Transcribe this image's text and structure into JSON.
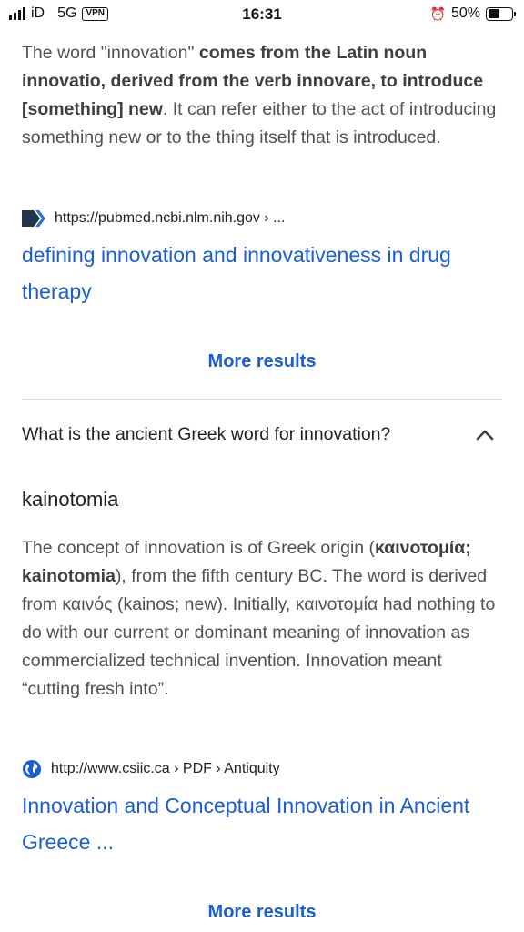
{
  "status_bar": {
    "carrier": "iD",
    "network": "5G",
    "vpn": "VPN",
    "time": "16:31",
    "battery_text": "50%",
    "battery_level": 0.5
  },
  "result1": {
    "para_intro": "The word \"innovation\" ",
    "para_bold": "comes from the Latin noun innovatio, derived from the verb innovare, to introduce [something] new",
    "para_rest": ". It can refer either to the act of introducing something new or to the thing itself that is introduced.",
    "source_url": "https://pubmed.ncbi.nlm.nih.gov › ...",
    "link_title": "defining innovation and innovativeness in drug therapy",
    "more_results": "More results"
  },
  "faq": {
    "question": "What is the ancient Greek word for innovation?",
    "answer": "kainotomia",
    "para_a": "The concept of innovation is of Greek origin (",
    "para_bold": "καινοτομία; kainotomia",
    "para_b": "), from the fifth century BC. The word is derived from καινός (kainos; new). Initially, καινοτομία had nothing to do with our current or dominant meaning of innovation as commercialized technical invention. Innovation meant “cutting fresh into”.",
    "source_url": "http://www.csiic.ca › PDF › Antiquity",
    "link_title": "Innovation and Conceptual Innovation in Ancient Greece ...",
    "more_results": "More results"
  },
  "colors": {
    "link": "#1a5dd5",
    "text": "#4d5156",
    "divider": "#dadce0"
  }
}
